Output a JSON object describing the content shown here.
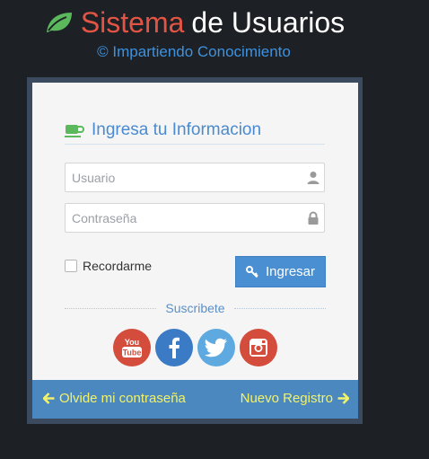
{
  "header": {
    "title_part1": "Sistema",
    "title_part2": "de Usuarios",
    "subtitle": "© Impartiendo Conocimiento"
  },
  "form": {
    "heading": "Ingresa tu Informacion",
    "username_placeholder": "Usuario",
    "password_placeholder": "Contraseña",
    "remember_label": "Recordarme",
    "login_label": "Ingresar",
    "subscribe_label": "Suscribete"
  },
  "footer": {
    "forgot_label": "Olvide mi contraseña",
    "register_label": "Nuevo Registro"
  },
  "icons": [
    "leaf-icon",
    "coffee-cup-icon",
    "user-icon",
    "lock-icon",
    "key-icon",
    "youtube-icon",
    "facebook-icon",
    "twitter-icon",
    "instagram-icon",
    "arrow-left-icon",
    "arrow-right-icon"
  ],
  "colors": {
    "background": "#1d2024",
    "title_red": "#e25545",
    "leaf_green": "#5cb85c",
    "accent_blue": "#4a8fd2",
    "footer_blue": "#4b88c0",
    "footer_link": "#f2f26a",
    "youtube": "#d34c3c",
    "facebook": "#3b7ac4",
    "twitter": "#5ea9df",
    "instagram": "#d34c3c"
  }
}
